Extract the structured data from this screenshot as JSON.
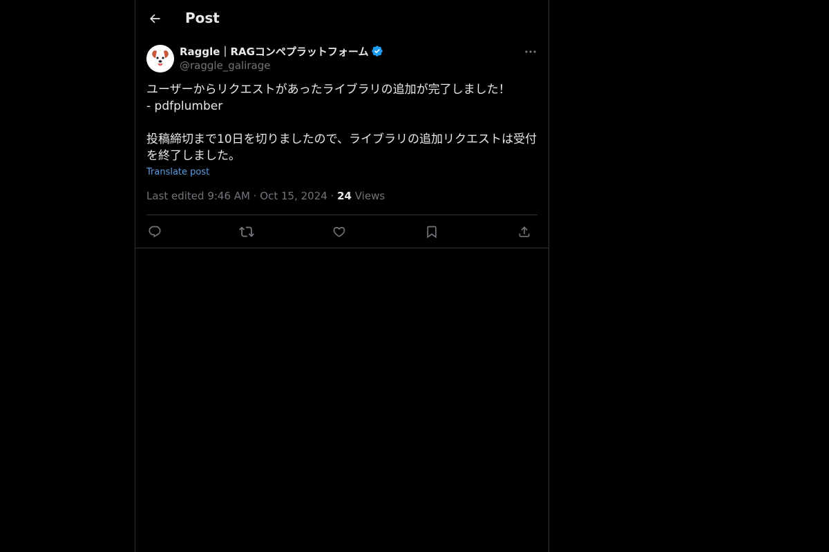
{
  "header": {
    "title": "Post",
    "back_icon": "arrow-left-icon"
  },
  "author": {
    "name": "Raggle｜RAGコンペプラットフォーム",
    "handle": "@raggle_galirage",
    "verified": true,
    "verified_color": "#1d9bf0",
    "avatar_icon": "dog-mascot-avatar"
  },
  "post": {
    "text": "ユーザーからリクエストがあったライブラリの追加が完了しました！\n- pdfplumber\n\n投稿締切まで10日を切りましたので、ライブラリの追加リクエストは受付を終了しました。",
    "translate_label": "Translate post",
    "edited_label": "Last edited 9:46 AM · Oct 15, 2024 · ",
    "views_count": "24",
    "views_label": " Views"
  },
  "actions": [
    {
      "name": "reply",
      "icon": "reply-icon"
    },
    {
      "name": "repost",
      "icon": "repost-icon"
    },
    {
      "name": "like",
      "icon": "heart-icon"
    },
    {
      "name": "bookmark",
      "icon": "bookmark-icon"
    },
    {
      "name": "share",
      "icon": "share-icon"
    }
  ],
  "colors": {
    "background": "#000000",
    "text": "#e7e9ea",
    "secondary": "#71767b",
    "link": "#5c9ce6",
    "border": "#2f3336"
  }
}
